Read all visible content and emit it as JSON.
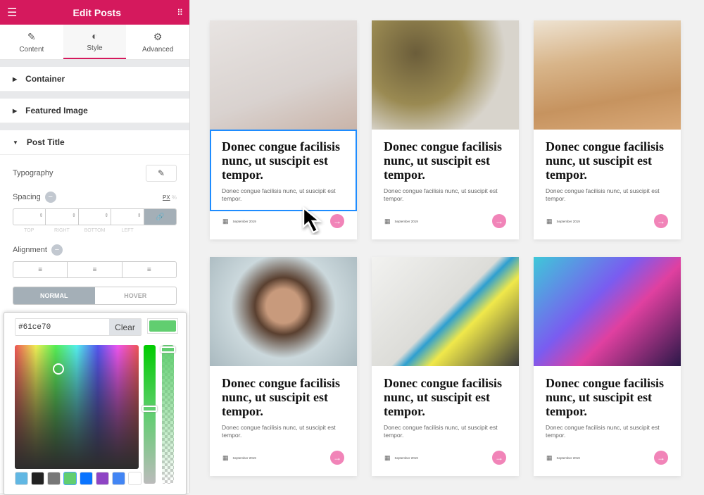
{
  "header": {
    "title": "Edit Posts",
    "menu_icon": "hamburger-icon",
    "apps_icon": "grid-icon"
  },
  "tabs": [
    {
      "label": "Content",
      "icon": "pencil-icon"
    },
    {
      "label": "Style",
      "icon": "contrast-icon",
      "active": true
    },
    {
      "label": "Advanced",
      "icon": "gear-icon"
    }
  ],
  "sections": {
    "container": "Container",
    "featured_image": "Featured Image",
    "post_title": "Post Title"
  },
  "controls": {
    "typography": "Typography",
    "spacing": "Spacing",
    "unit_px": "PX",
    "unit_pct": "%",
    "dims": [
      "TOP",
      "RIGHT",
      "BOTTOM",
      "LEFT"
    ],
    "alignment": "Alignment",
    "normal": "NORMAL",
    "hover": "HOVER"
  },
  "picker": {
    "hex": "#61ce70",
    "clear": "Clear",
    "current_color": "#61ce70",
    "swatches": [
      "#61b7e3",
      "#222222",
      "#777777",
      "#61ce70",
      "#0a74ff",
      "#8e44c4",
      "#4285f4",
      "#ffffff"
    ]
  },
  "accent": "#d5195d",
  "cards": [
    {
      "title": "Donec congue facilisis nunc, ut suscipit est tempor.",
      "excerpt": "Donec congue facilisis nunc, ut suscipit est tempor.",
      "date": "September 2019",
      "selected": true
    },
    {
      "title": "Donec congue facilisis nunc, ut suscipit est tempor.",
      "excerpt": "Donec congue facilisis nunc, ut suscipit est tempor.",
      "date": "September 2019"
    },
    {
      "title": "Donec congue facilisis nunc, ut suscipit est tempor.",
      "excerpt": "Donec congue facilisis nunc, ut suscipit est tempor.",
      "date": "September 2019"
    },
    {
      "title": "Donec congue facilisis nunc, ut suscipit est tempor.",
      "excerpt": "Donec congue facilisis nunc, ut suscipit est tempor.",
      "date": "September 2019"
    },
    {
      "title": "Donec congue facilisis nunc, ut suscipit est tempor.",
      "excerpt": "Donec congue facilisis nunc, ut suscipit est tempor.",
      "date": "September 2019"
    },
    {
      "title": "Donec congue facilisis nunc, ut suscipit est tempor.",
      "excerpt": "Donec congue facilisis nunc, ut suscipit est tempor.",
      "date": "September 2019"
    }
  ]
}
